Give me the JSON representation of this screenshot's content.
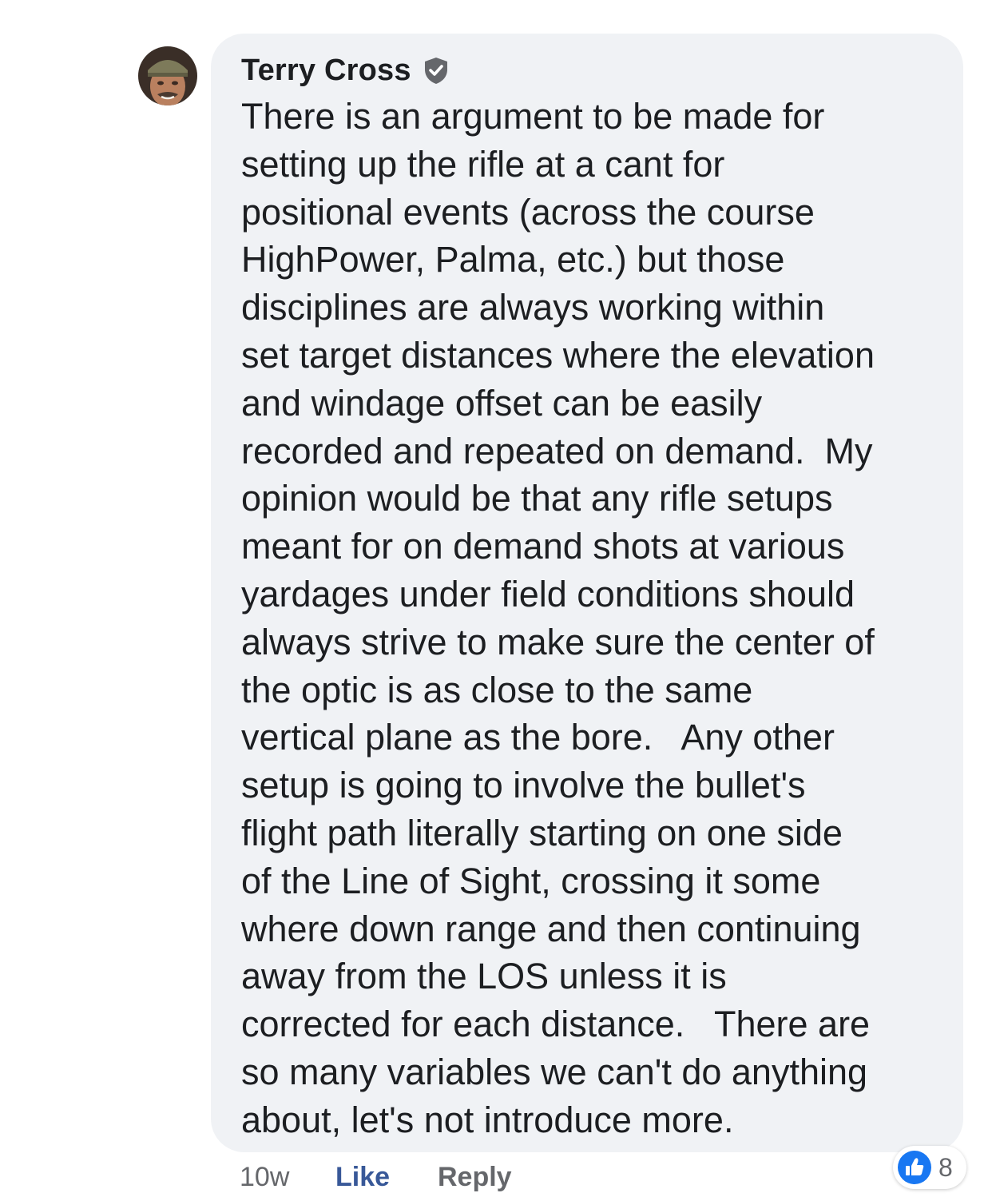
{
  "comment": {
    "author": "Terry Cross",
    "badge_icon": "verified-shield-check-icon",
    "lines": [
      "There is an argument to be made for",
      "setting up the rifle at a cant for",
      "positional events (across the course",
      "HighPower, Palma, etc.) but those",
      "disciplines are always working within",
      "set target distances where the elevation",
      "and windage offset can be easily",
      "recorded and repeated on demand.  My",
      "opinion would be that any rifle setups",
      "meant for on demand shots at various",
      "yardages under field conditions should",
      "always strive to make sure the center of",
      "the optic is as close to the same",
      "vertical plane as the bore.   Any other",
      "setup is going to involve the bullet's",
      "flight path literally starting on one side",
      "of the Line of Sight, crossing it some",
      "where down range and then continuing",
      "away from the LOS unless it is",
      "corrected for each distance.   There are",
      "so many variables we can't do anything",
      "about, let's not introduce more."
    ],
    "time": "10w",
    "like_label": "Like",
    "reply_label": "Reply",
    "reaction_icon": "thumbs-up-icon",
    "reaction_count": "8"
  },
  "colors": {
    "bubble_bg": "#f0f2f5",
    "text": "#1c1e21",
    "meta": "#65676b",
    "link": "#385898",
    "like_blue": "#1877f2"
  }
}
